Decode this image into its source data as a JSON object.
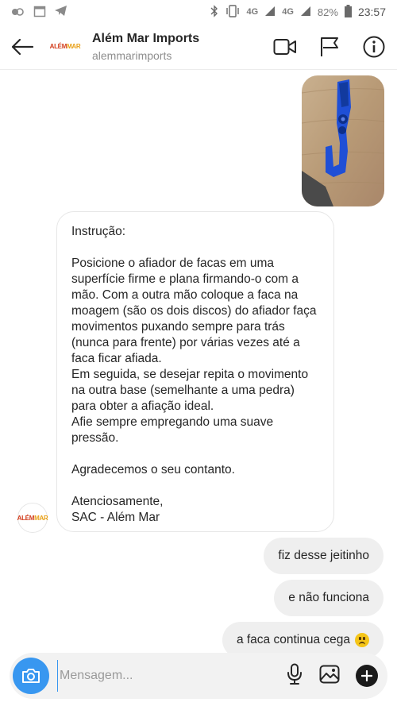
{
  "status_bar": {
    "network1": "4G",
    "network2": "4G",
    "battery": "82%",
    "time": "23:57"
  },
  "header": {
    "title": "Além Mar Imports",
    "username": "alemmarimports",
    "logo_text_a": "ALÉM",
    "logo_text_b": "MAR"
  },
  "messages": {
    "incoming_text": "Instrução:\n\nPosicione o afiador de facas em uma superfície firme e plana firmando-o com a mão. Com a outra mão coloque a faca na moagem (são os dois discos) do afiador faça movimentos puxando sempre para trás (nunca para frente) por várias vezes até a faca ficar afiada.\nEm seguida, se desejar repita o movimento na outra base (semelhante a uma pedra) para obter a afiação ideal.\nAfie sempre empregando uma suave pressão.\n\nAgradecemos o seu contanto.\n\nAtenciosamente,\nSAC - Além Mar",
    "outgoing": [
      {
        "text": "fiz desse jeitinho"
      },
      {
        "text": "e não funciona"
      },
      {
        "text": "a faca continua cega"
      }
    ]
  },
  "composer": {
    "placeholder": "Mensagem..."
  },
  "colors": {
    "accent": "#3897f0",
    "outgoing_bubble": "#efefef",
    "brand_red": "#d23b1a",
    "product_blue": "#1f4fd6"
  }
}
